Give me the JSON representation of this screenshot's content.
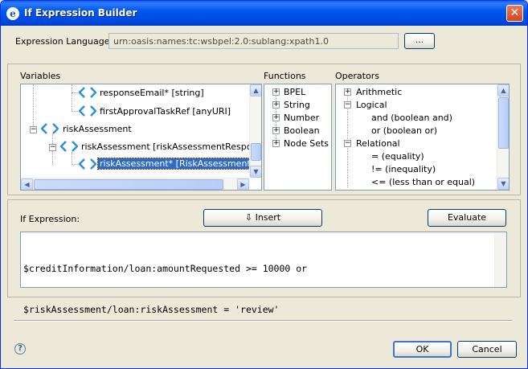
{
  "window": {
    "title": "If Expression Builder"
  },
  "expression_language": {
    "label": "Expression Language:",
    "value": "urn:oasis:names:tc:wsbpel:2.0:sublang:xpath1.0",
    "browse_label": "..."
  },
  "variables": {
    "header": "Variables",
    "items": [
      {
        "label": "responseEmail* [string]"
      },
      {
        "label": "firstApprovalTaskRef [anyURI]"
      },
      {
        "label": "riskAssessment"
      },
      {
        "label": "riskAssessment [riskAssessmentResponse]"
      },
      {
        "label": "riskAssessment* [RiskAssessment]",
        "selected": true
      }
    ]
  },
  "functions": {
    "header": "Functions",
    "items": [
      "BPEL",
      "String",
      "Number",
      "Boolean",
      "Node Sets"
    ]
  },
  "operators": {
    "header": "Operators",
    "items": [
      {
        "label": "Arithmetic"
      },
      {
        "label": "Logical"
      },
      {
        "label": "and (boolean and)"
      },
      {
        "label": "or (boolean or)"
      },
      {
        "label": "Relational"
      },
      {
        "label": "= (equality)"
      },
      {
        "label": "!= (inequality)"
      },
      {
        "label": "<= (less than or equal)"
      }
    ]
  },
  "if_expression": {
    "label": "If Expression:",
    "insert_label": "⇩ Insert",
    "evaluate_label": "Evaluate",
    "lines": [
      "$creditInformation/loan:amountRequested >= 10000 or",
      "$riskAssessment/loan:riskAssessment = 'review'"
    ]
  },
  "footer": {
    "ok_label": "OK",
    "cancel_label": "Cancel"
  }
}
